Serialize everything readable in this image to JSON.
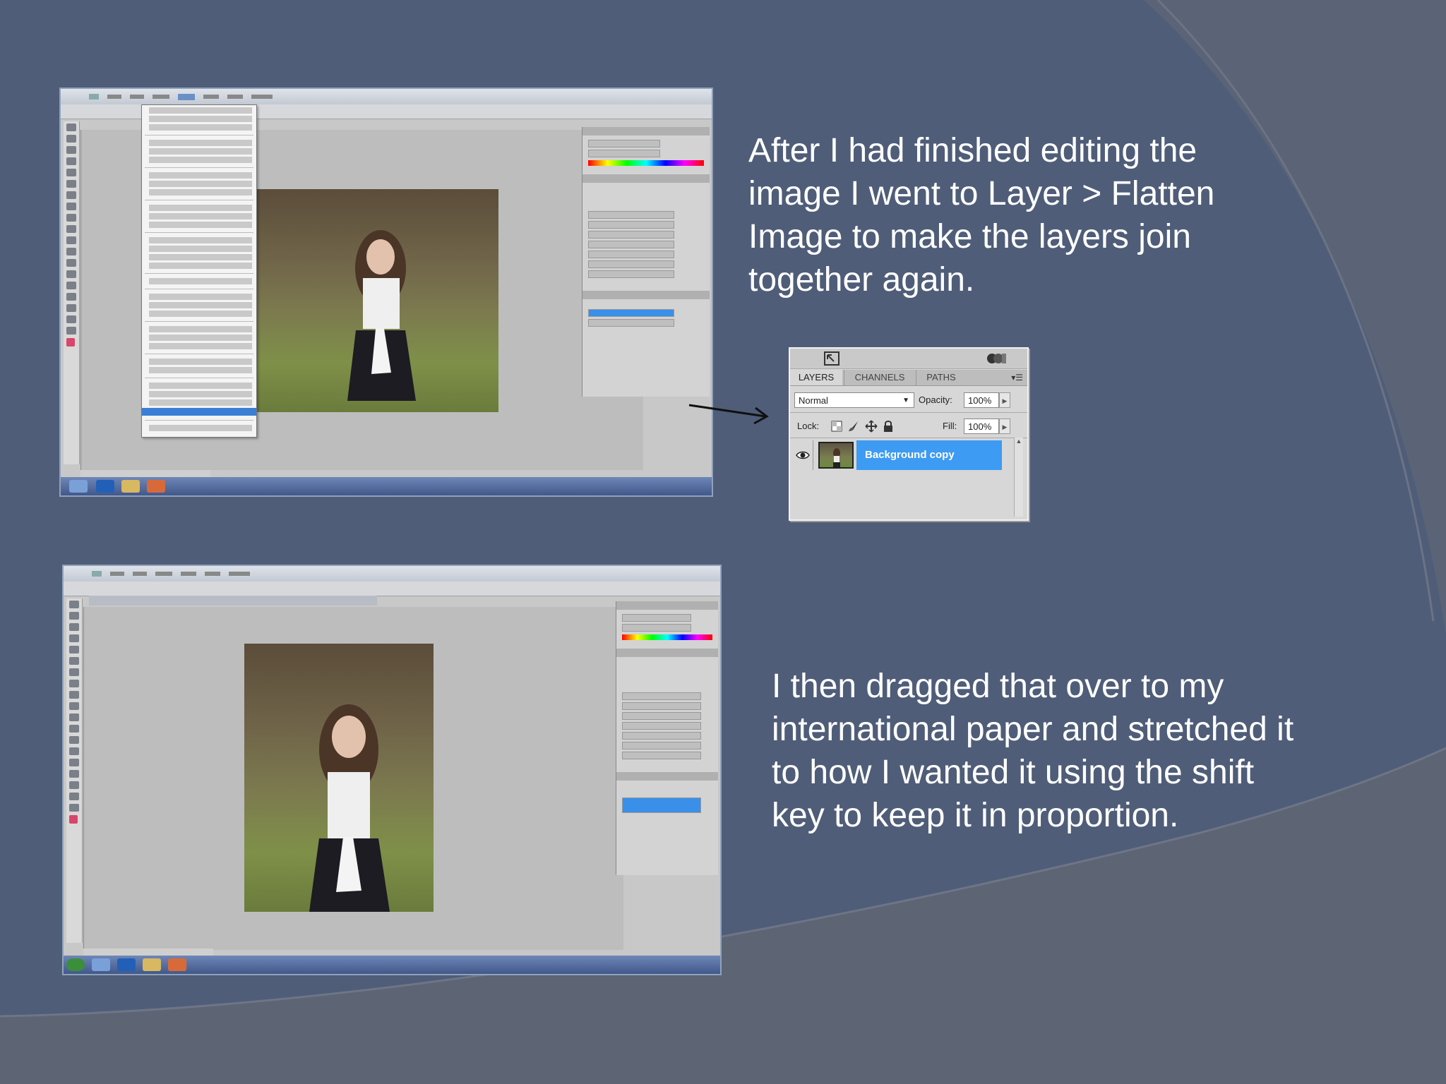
{
  "slide": {
    "caption_top": "After I had finished editing the image I went to Layer > Flatten Image to make the layers join together again.",
    "caption_bottom": "I then dragged that over to my international paper and stretched it to how I wanted it using the shift key to keep it in proportion."
  },
  "layers_panel": {
    "tabs": [
      "LAYERS",
      "CHANNELS",
      "PATHS"
    ],
    "blend_mode": "Normal",
    "opacity_label": "Opacity:",
    "opacity_value": "100%",
    "lock_label": "Lock:",
    "fill_label": "Fill:",
    "fill_value": "100%",
    "layer_name": "Background copy"
  },
  "colors": {
    "slide_background": "#4f5d78",
    "selection_blue": "#3d9bf3"
  },
  "icons": {
    "eye": "eye-icon",
    "lock": "lock-icon",
    "move": "move-icon",
    "brush": "brush-icon",
    "transparency_lock": "lock-transparent-icon",
    "panel_menu": "panel-menu-icon",
    "dropdown": "chevron-down-icon",
    "arrow": "arrow-right-icon"
  }
}
